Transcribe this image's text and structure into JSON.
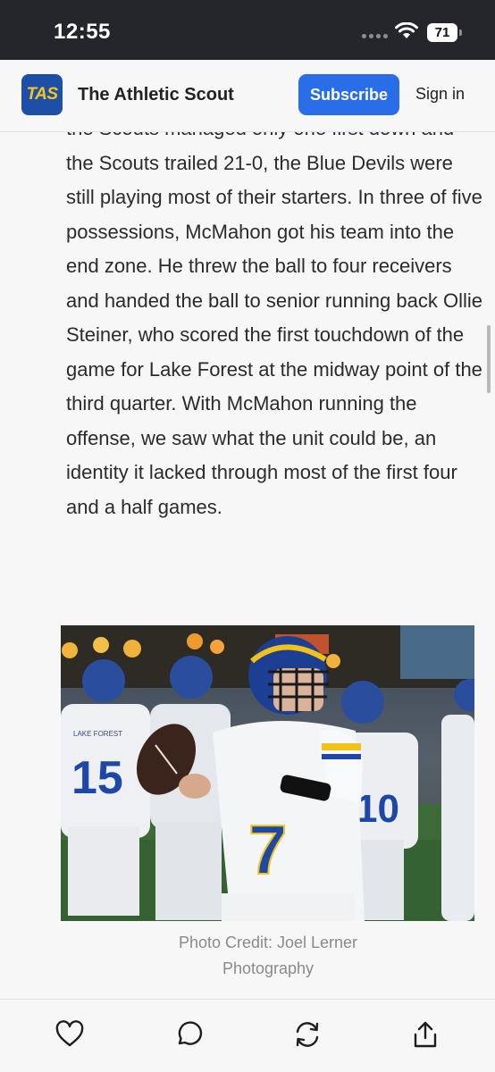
{
  "status_bar": {
    "time": "12:55",
    "battery": "71"
  },
  "header": {
    "logo_text": "TAS",
    "site_name": "The Athletic Scout",
    "subscribe_label": "Subscribe",
    "signin_label": "Sign in"
  },
  "article": {
    "paragraph": "the Scouts managed only one first down and the Scouts trailed 21-0, the Blue Devils were still playing most of their starters. In three of five possessions, McMahon got his team into the end zone. He threw the ball to four receivers and handed the ball to senior running back Ollie Steiner, who scored the first touchdown of the game for Lake Forest at the midway point of the third quarter. With McMahon running the offense, we saw what the unit could be, an identity it lacked through most of the first four and a half games.",
    "photo": {
      "jersey_left": "15",
      "jersey_center": "7",
      "jersey_right": "10",
      "jersey_text": "LAKE FOREST"
    },
    "photo_caption": "Photo Credit: Joel Lerner Photography"
  },
  "toolbar": {
    "icons": [
      "heart-icon",
      "comment-icon",
      "refresh-icon",
      "share-icon"
    ]
  }
}
